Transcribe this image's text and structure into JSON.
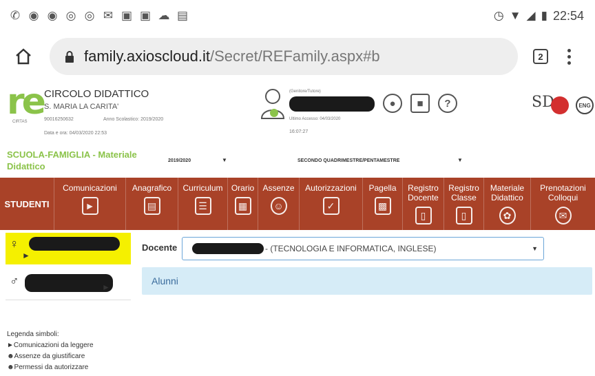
{
  "statusbar": {
    "time": "22:54"
  },
  "browser": {
    "url_host": "family.axioscloud.it",
    "url_path": "/Secret/REFamily.aspx#b",
    "tab_count": "2"
  },
  "header": {
    "school_name": "CIRCOLO DIDATTICO",
    "school_place": "S. MARIA LA CARITA'",
    "school_code": "90016250632",
    "school_year": "Anno Scolastico: 2019/2020",
    "datetime": "Data e ora: 04/03/2020 22:53",
    "user_role": "(Genitore/Tutore)",
    "last_access": "Ultimo Accesso: 04/03/2020",
    "last_access_time": "16:07:27",
    "logo_sub": "CIRTAS"
  },
  "subbar": {
    "title": "SCUOLA-FAMIGLIA - Materiale Didattico",
    "year": "2019/2020",
    "period": "SECONDO QUADRIMESTRE/PENTAMESTRE"
  },
  "nav": {
    "section": "STUDENTI",
    "items": [
      {
        "label": "Comunicazioni",
        "icon": "megaphone-icon"
      },
      {
        "label": "Anagrafico",
        "icon": "id-card-icon"
      },
      {
        "label": "Curriculum",
        "icon": "document-icon"
      },
      {
        "label": "Orario",
        "icon": "calendar-grid-icon"
      },
      {
        "label": "Assenze",
        "icon": "face-icon"
      },
      {
        "label": "Autorizzazioni",
        "icon": "calendar-check-icon"
      },
      {
        "label": "Pagella",
        "icon": "report-card-icon"
      },
      {
        "label": "Registro Docente",
        "icon": "tablet-icon"
      },
      {
        "label": "Registro Classe",
        "icon": "tablet-icon"
      },
      {
        "label": "Materiale Didattico",
        "icon": "shapes-icon"
      },
      {
        "label": "Prenotazioni Colloqui",
        "icon": "chat-icon"
      }
    ]
  },
  "main": {
    "docente_label": "Docente",
    "docente_value": "- (TECNOLOGIA E INFORMATICA, INGLESE)",
    "alunni_label": "Alunni"
  },
  "legend": {
    "title": "Legenda simboli:",
    "item1": "Comunicazioni da leggere",
    "item2": "Assenze da giustificare",
    "item3": "Permessi da autorizzare"
  }
}
